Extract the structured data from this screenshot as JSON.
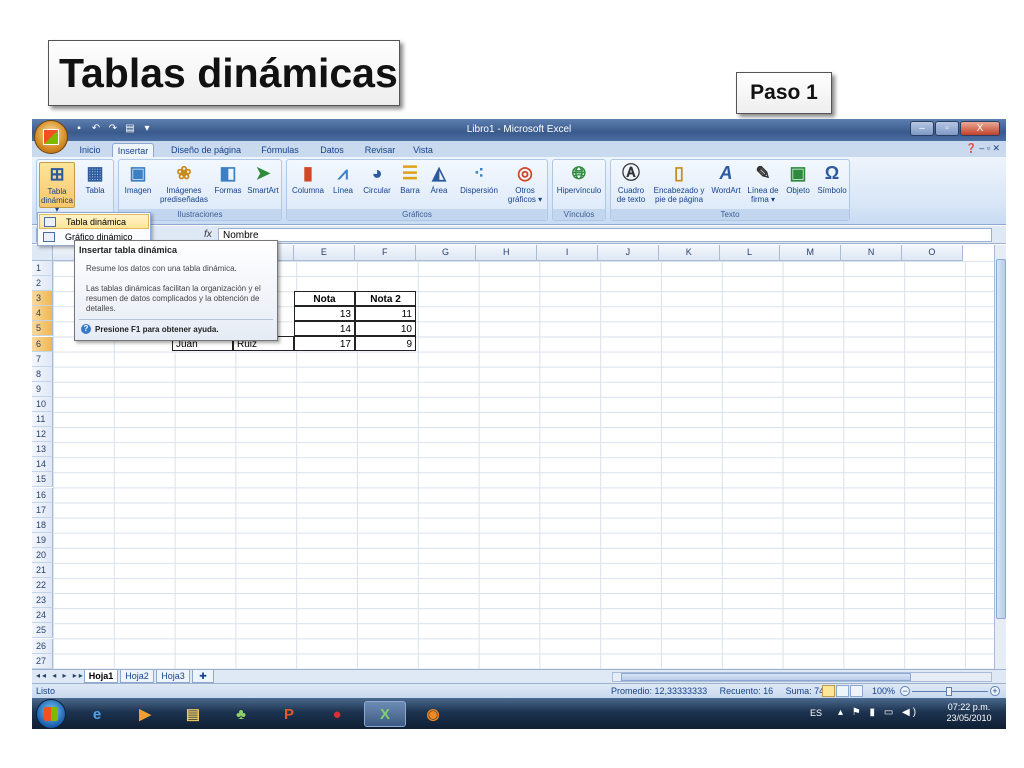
{
  "slide": {
    "title": "Tablas dinámicas",
    "step": "Paso 1"
  },
  "window": {
    "title": "Libro1 - Microsoft Excel",
    "controls": [
      "–",
      "▫",
      "X"
    ]
  },
  "tabs": [
    {
      "label": "Inicio",
      "active": false
    },
    {
      "label": "Insertar",
      "active": true
    },
    {
      "label": "Diseño de página",
      "active": false
    },
    {
      "label": "Fórmulas",
      "active": false
    },
    {
      "label": "Datos",
      "active": false
    },
    {
      "label": "Revisar",
      "active": false
    },
    {
      "label": "Vista",
      "active": false
    }
  ],
  "ribbon": {
    "tablas": {
      "tabla_dinamica_1": "Tabla",
      "tabla_dinamica_2": "dinámica ▾",
      "tabla": "Tabla"
    },
    "ilustraciones": {
      "label": "Ilustraciones",
      "imagen": "Imagen",
      "imagenes_1": "Imágenes",
      "imagenes_2": "prediseñadas",
      "formas": "Formas",
      "smartart": "SmartArt"
    },
    "graficos": {
      "label": "Gráficos",
      "columna": "Columna",
      "linea": "Línea",
      "circular": "Circular",
      "barra": "Barra",
      "area": "Área",
      "dispersion": "Dispersión",
      "otros_1": "Otros",
      "otros_2": "gráficos ▾"
    },
    "vinculos": {
      "label": "Vínculos",
      "hipervinculo": "Hipervínculo"
    },
    "texto": {
      "label": "Texto",
      "cuadro_1": "Cuadro",
      "cuadro_2": "de texto",
      "encabezado_1": "Encabezado y",
      "encabezado_2": "pie de página",
      "wordart": "WordArt",
      "linea_firma_1": "Línea de",
      "linea_firma_2": "firma ▾",
      "objeto": "Objeto",
      "simbolo": "Símbolo"
    }
  },
  "dropdown": {
    "items": [
      "Tabla dinámica",
      "Gráfico dinámico"
    ]
  },
  "tooltip": {
    "title": "Insertar tabla dinámica",
    "desc": "Resume los datos con una tabla dinámica.",
    "desc2": "Las tablas dinámicas facilitan la organización y el resumen de datos complicados y la obtención de detalles.",
    "help": "Presione F1 para obtener ayuda."
  },
  "formula_bar": {
    "fx": "fx",
    "content": "Nombre"
  },
  "columns": [
    "E",
    "F",
    "G",
    "H",
    "I",
    "J",
    "K",
    "L",
    "M",
    "N",
    "O"
  ],
  "rows": [
    "1",
    "2",
    "3",
    "4",
    "5",
    "6",
    "7",
    "8",
    "9",
    "10",
    "11",
    "12",
    "13",
    "14",
    "15",
    "16",
    "17",
    "18",
    "19",
    "20",
    "21",
    "22",
    "23",
    "24",
    "25",
    "26",
    "27"
  ],
  "table": {
    "header_e": "Nota",
    "header_f": "Nota 2",
    "r4_e": "13",
    "r4_f": "11",
    "r5_e": "14",
    "r5_f": "10",
    "r6_c": "Juan",
    "r6_d": "Ruiz",
    "r6_e": "17",
    "r6_f": "9"
  },
  "sheets": [
    "Hoja1",
    "Hoja2",
    "Hoja3"
  ],
  "status": {
    "ready": "Listo",
    "promedio": "Promedio: 12,33333333",
    "recuento": "Recuento: 16",
    "suma": "Suma: 74",
    "zoom": "100%"
  },
  "taskbar": {
    "lang": "ES",
    "time": "07:22 p.m.",
    "date": "23/05/2010"
  }
}
